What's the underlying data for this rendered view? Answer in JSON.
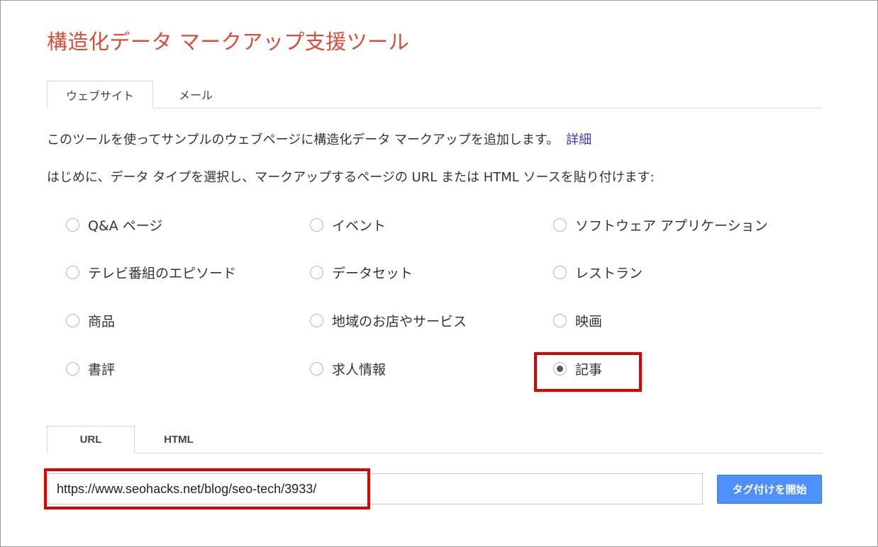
{
  "page": {
    "title": "構造化データ マークアップ支援ツール"
  },
  "top_tabs": [
    {
      "label": "ウェブサイト",
      "active": true
    },
    {
      "label": "メール",
      "active": false
    }
  ],
  "description": {
    "line1": "このツールを使ってサンプルのウェブページに構造化データ マークアップを追加します。",
    "line1_link": "詳細",
    "line2": "はじめに、データ タイプを選択し、マークアップするページの URL または HTML ソースを貼り付けます:"
  },
  "data_types": [
    {
      "label": "Q&A ページ",
      "checked": false
    },
    {
      "label": "イベント",
      "checked": false
    },
    {
      "label": "ソフトウェア アプリケーション",
      "checked": false
    },
    {
      "label": "テレビ番組のエピソード",
      "checked": false
    },
    {
      "label": "データセット",
      "checked": false
    },
    {
      "label": "レストラン",
      "checked": false
    },
    {
      "label": "商品",
      "checked": false
    },
    {
      "label": "地域のお店やサービス",
      "checked": false
    },
    {
      "label": "映画",
      "checked": false
    },
    {
      "label": "書評",
      "checked": false
    },
    {
      "label": "求人情報",
      "checked": false
    },
    {
      "label": "記事",
      "checked": true
    }
  ],
  "source_tabs": [
    {
      "label": "URL",
      "active": true
    },
    {
      "label": "HTML",
      "active": false
    }
  ],
  "url_input": {
    "value": "https://www.seohacks.net/blog/seo-tech/3933/"
  },
  "start_button": {
    "label": "タグ付けを開始"
  },
  "colors": {
    "title": "#dd4b39",
    "link": "#3b33c9",
    "button": "#4d90fe",
    "highlight": "#e00000"
  }
}
